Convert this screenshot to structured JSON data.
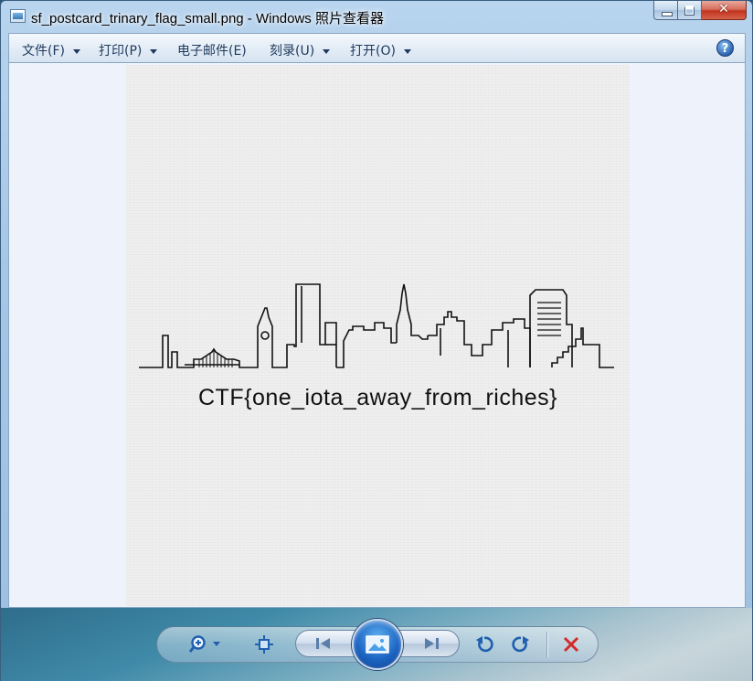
{
  "window": {
    "title": "sf_postcard_trinary_flag_small.png - Windows 照片查看器",
    "close_glyph": "✕"
  },
  "menu": {
    "file": "文件(F)",
    "print": "打印(P)",
    "email": "电子邮件(E)",
    "burn": "刻录(U)",
    "open": "打开(O)",
    "help_glyph": "?"
  },
  "image": {
    "flag_text": "CTF{one_iota_away_from_riches}"
  },
  "controls": {
    "zoom": "magnifier-zoom-icon",
    "actual_size": "actual-size-icon",
    "previous": "previous-icon",
    "slideshow": "slideshow-icon",
    "next": "next-icon",
    "rotate_ccw": "rotate-counterclockwise-icon",
    "rotate_cw": "rotate-clockwise-icon",
    "delete": "delete-icon"
  },
  "colors": {
    "accent_blue": "#1d66c4",
    "delete_red": "#d42a2a",
    "menu_text": "#1e395b"
  }
}
